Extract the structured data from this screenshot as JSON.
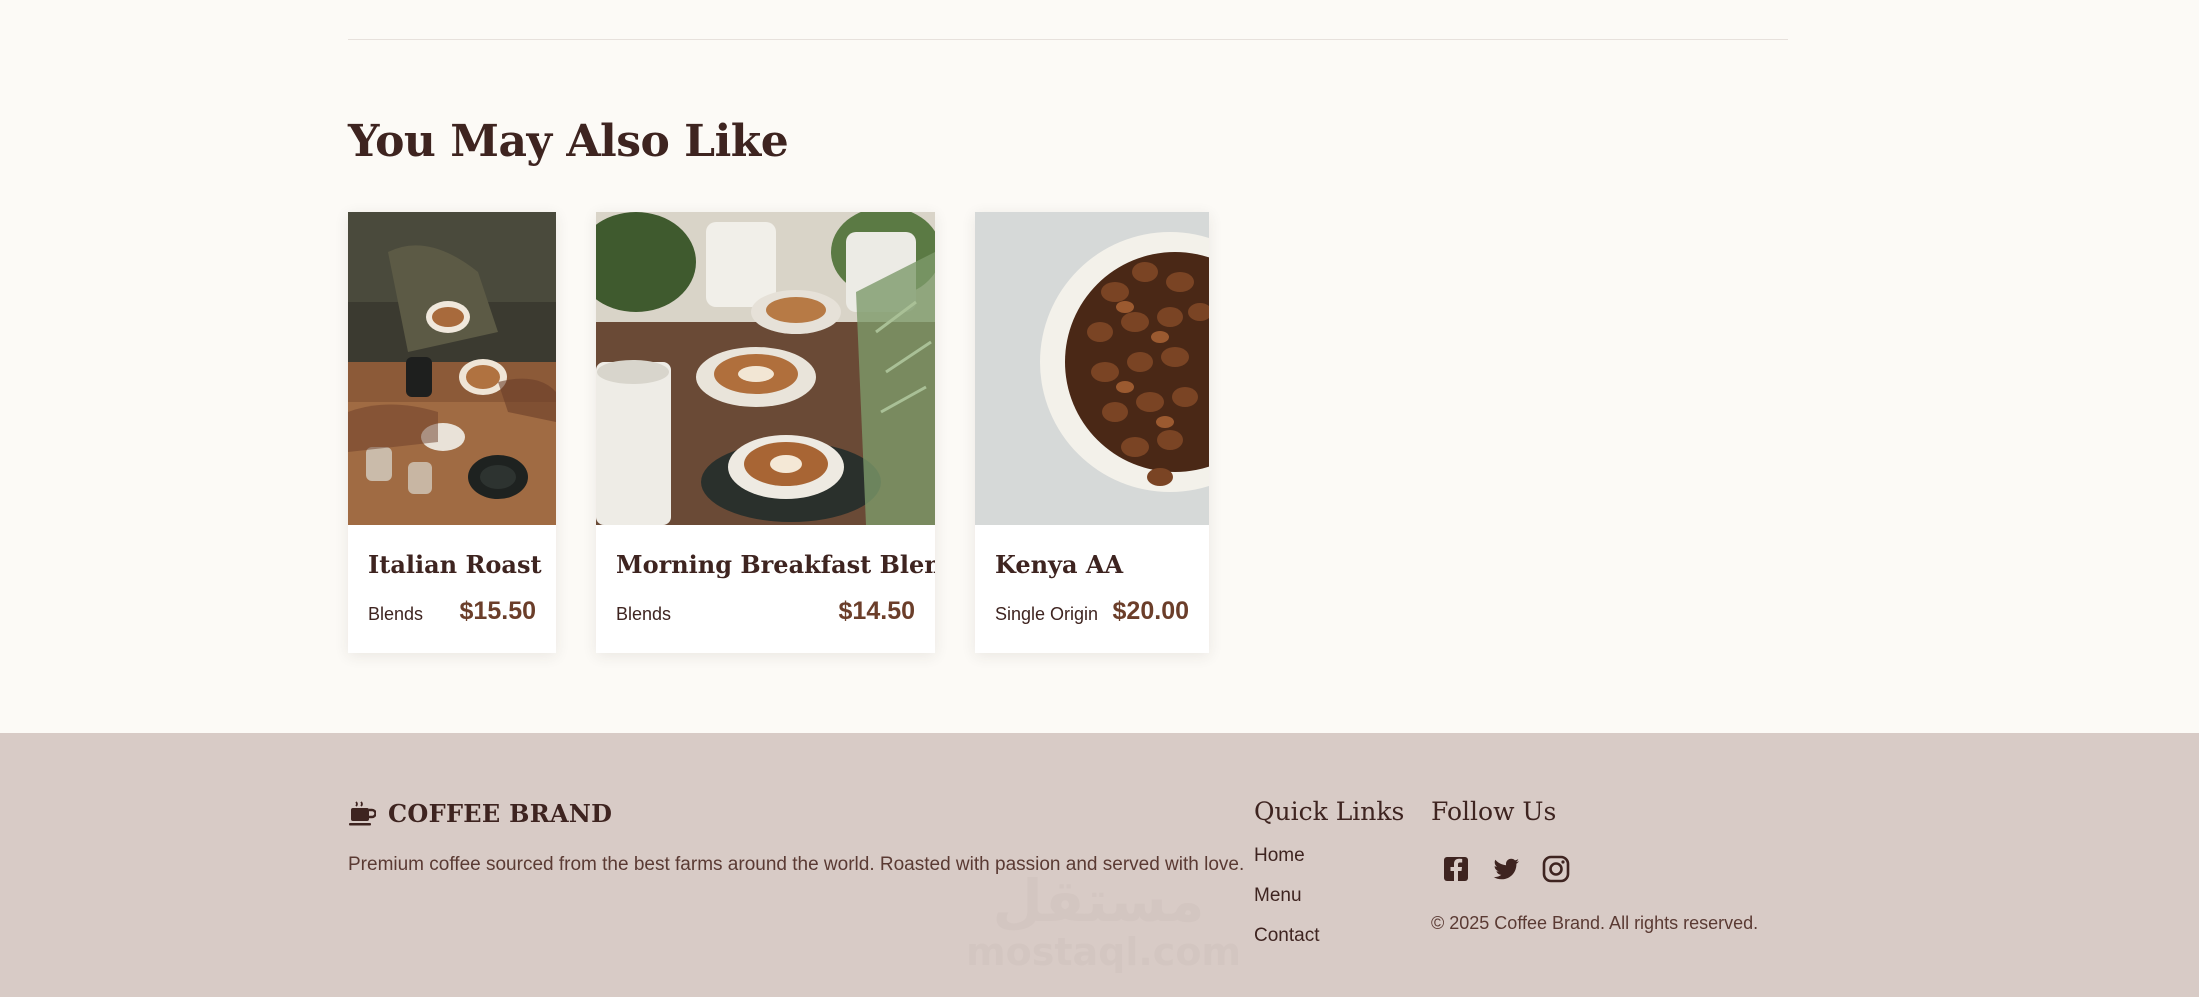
{
  "section": {
    "title": "You May Also Like"
  },
  "products": [
    {
      "name": "Italian Roast",
      "category": "Blends",
      "price": "$15.50",
      "image": "people-toasting-lattes-photo"
    },
    {
      "name": "Morning Breakfast Blend",
      "category": "Blends",
      "price": "$14.50",
      "image": "latte-cups-with-plants-photo"
    },
    {
      "name": "Kenya AA",
      "category": "Single Origin",
      "price": "$20.00",
      "image": "bowl-of-coffee-beans-photo"
    }
  ],
  "footer": {
    "brand_name": "COFFEE BRAND",
    "brand_icon": "coffee-cup-icon",
    "tagline": "Premium coffee sourced from the best farms around the world. Roasted with passion and served with love.",
    "quick_links_title": "Quick Links",
    "quick_links": [
      "Home",
      "Menu",
      "Contact"
    ],
    "follow_title": "Follow Us",
    "social_icons": [
      "facebook-icon",
      "twitter-icon",
      "instagram-icon"
    ],
    "copyright": "© 2025 Coffee Brand. All rights reserved."
  },
  "watermark": {
    "arabic": "مستقل",
    "latin": "mostaql.com"
  },
  "colors": {
    "background": "#fcfaf6",
    "footer_background": "#d8cbc6",
    "heading": "#3e2420",
    "price": "#6b3e2a"
  }
}
